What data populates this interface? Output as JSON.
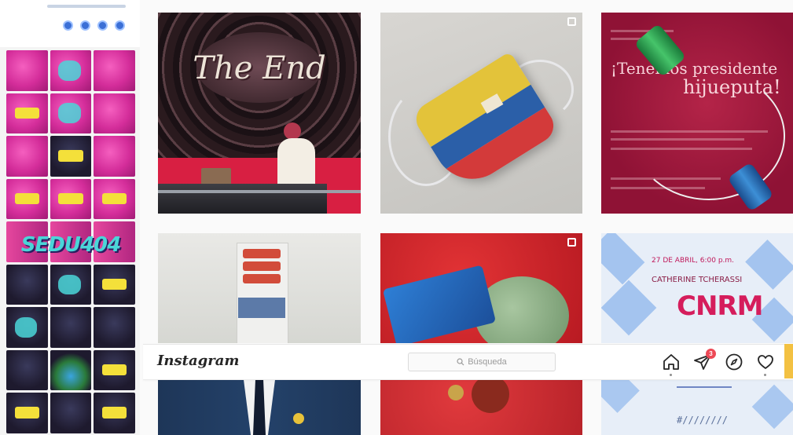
{
  "topbar": {
    "logo_text": "Instagram",
    "search_placeholder": "Búsqueda",
    "icons": [
      "home-icon",
      "direct-messages-icon",
      "explore-icon",
      "activity-heart-icon"
    ],
    "messages_badge": "3",
    "accent_color": "#ed4956"
  },
  "posts": [
    {
      "id": "post-1",
      "text": "The End"
    },
    {
      "id": "post-2"
    },
    {
      "id": "post-3",
      "text_lines": [
        "¡Tenemos presidente",
        "hijueputa!"
      ]
    },
    {
      "id": "post-4"
    },
    {
      "id": "post-5"
    },
    {
      "id": "post-6",
      "info": "27 DE ABRIL, 6:00 p.m.",
      "artist": "CATHERINE TCHERASSI",
      "title": "CNRM"
    },
    {
      "id": "post-7"
    },
    {
      "id": "post-8"
    },
    {
      "id": "post-9"
    }
  ],
  "side_preview": {
    "headline": "SEDU404"
  }
}
